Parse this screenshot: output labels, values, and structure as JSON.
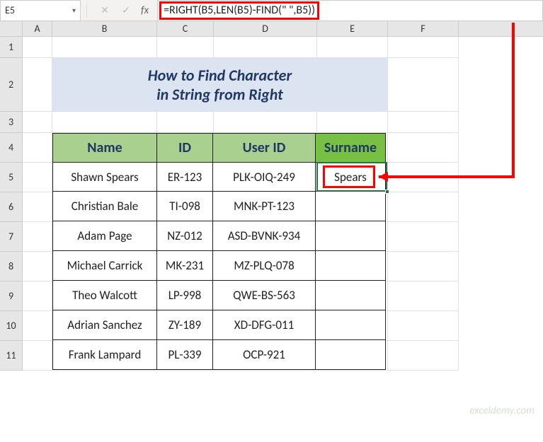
{
  "nameBox": {
    "value": "E5"
  },
  "formulaBar": {
    "formula": "=RIGHT(B5,LEN(B5)-FIND(\" \",B5))"
  },
  "columns": [
    "A",
    "B",
    "C",
    "D",
    "E",
    "F"
  ],
  "rowNumbers": [
    "1",
    "2",
    "3",
    "4",
    "5",
    "6",
    "7",
    "8",
    "9",
    "10",
    "11"
  ],
  "title": {
    "line1": "How to Find Character",
    "line2": "in String from Right"
  },
  "tableHeaders": {
    "name": "Name",
    "id": "ID",
    "userId": "User ID",
    "surname": "Surname"
  },
  "rows": [
    {
      "name": "Shawn Spears",
      "id": "ER-123",
      "userId": "PLK-OIQ-249",
      "surname": "Spears"
    },
    {
      "name": "Christian Bale",
      "id": "TI-098",
      "userId": "MNK-PT-123",
      "surname": ""
    },
    {
      "name": "Adam Page",
      "id": "NZ-012",
      "userId": "ASD-BVNK-934",
      "surname": ""
    },
    {
      "name": "Michael Carrick",
      "id": "MK-231",
      "userId": "MZ-PLQ-078",
      "surname": ""
    },
    {
      "name": "Theo Walcott",
      "id": "LP-998",
      "userId": "QWE-BS-563",
      "surname": ""
    },
    {
      "name": "Adrian Sanchez",
      "id": "ZY-189",
      "userId": "XD-DFG-011",
      "surname": ""
    },
    {
      "name": "Frank Lampard",
      "id": "PL-339",
      "userId": "OCP-921",
      "surname": ""
    }
  ],
  "watermark": "exceldemy.com"
}
